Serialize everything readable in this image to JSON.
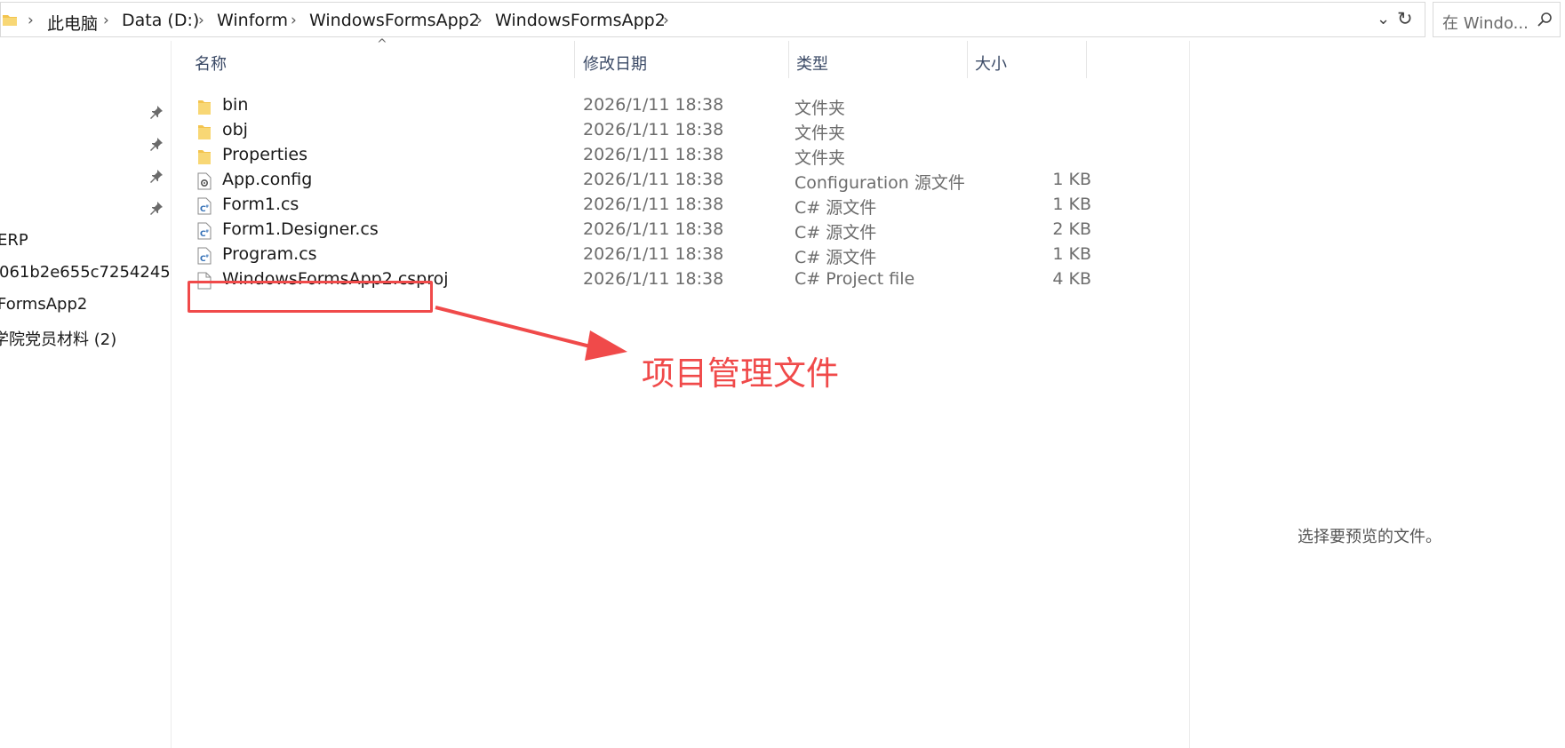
{
  "address_bar": {
    "breadcrumbs": [
      "此电脑",
      "Data (D:)",
      "Winform",
      "WindowsFormsApp2",
      "WindowsFormsApp2"
    ],
    "folder_icon": "folder-icon",
    "dropdown_icon": "chevron-down-icon",
    "refresh_icon": "refresh-icon"
  },
  "search": {
    "placeholder": "在 Windo...",
    "icon": "search-icon"
  },
  "nav": {
    "pinned_icons": [
      "pin-icon",
      "pin-icon",
      "pin-icon",
      "pin-icon"
    ],
    "items": [
      {
        "label": "ERP"
      },
      {
        "label": "061b2e655c7254245"
      },
      {
        "label": "FormsApp2"
      },
      {
        "label": "学院党员材料 (2)"
      }
    ]
  },
  "columns": {
    "name": "名称",
    "modified": "修改日期",
    "type": "类型",
    "size": "大小"
  },
  "files": [
    {
      "name": "bin",
      "date": "2026/1/11 18:38",
      "type": "文件夹",
      "size": "",
      "icon": "folder-icon"
    },
    {
      "name": "obj",
      "date": "2026/1/11 18:38",
      "type": "文件夹",
      "size": "",
      "icon": "folder-icon"
    },
    {
      "name": "Properties",
      "date": "2026/1/11 18:38",
      "type": "文件夹",
      "size": "",
      "icon": "folder-icon"
    },
    {
      "name": "App.config",
      "date": "2026/1/11 18:38",
      "type": "Configuration 源文件",
      "size": "1 KB",
      "icon": "config-file-icon"
    },
    {
      "name": "Form1.cs",
      "date": "2026/1/11 18:38",
      "type": "C# 源文件",
      "size": "1 KB",
      "icon": "csharp-file-icon"
    },
    {
      "name": "Form1.Designer.cs",
      "date": "2026/1/11 18:38",
      "type": "C# 源文件",
      "size": "2 KB",
      "icon": "csharp-file-icon"
    },
    {
      "name": "Program.cs",
      "date": "2026/1/11 18:38",
      "type": "C# 源文件",
      "size": "1 KB",
      "icon": "csharp-file-icon"
    },
    {
      "name": "WindowsFormsApp2.csproj",
      "date": "2026/1/11 18:38",
      "type": "C# Project file",
      "size": "4 KB",
      "icon": "blank-file-icon"
    }
  ],
  "annotation": {
    "text": "项目管理文件",
    "color": "#f04a4a"
  },
  "preview": {
    "message": "选择要预览的文件。"
  }
}
